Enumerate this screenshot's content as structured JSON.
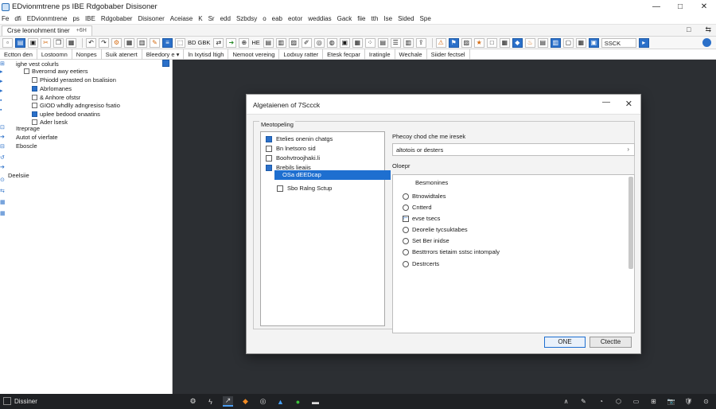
{
  "window": {
    "title": "EDvionmtrene ps IBE Rdgobaber Disisoner",
    "controls": {
      "minimize": "—",
      "maximize": "□",
      "close": "✕"
    }
  },
  "menu": {
    "items": [
      "Fe",
      "dfi",
      "EDvionmtrene",
      "ps",
      "IBE",
      "Rdgobaber",
      "Disisoner",
      "Aceiase",
      "K",
      "Sr",
      "edd",
      "Szbdsy",
      "o",
      "eab",
      "eotor",
      "weddias",
      "Gack",
      "fiie",
      "tth",
      "Ise",
      "Sided",
      "Spe"
    ]
  },
  "address": {
    "tab_label": "Crse leonohment tiner",
    "tab_suffix": "+6H",
    "right_items": [
      "□",
      "⇆"
    ]
  },
  "toolbar": {
    "text_a": "BD GBK",
    "text_b": "HE",
    "field_value": "SSCK"
  },
  "propbar": {
    "items": [
      "Ectton den",
      "Lostoomn",
      "Nonpes",
      "Suik atenert",
      "Bleedory e ▾",
      "ln Ixytisd ltigh",
      "Nemoot vereing",
      "Lodxuy ratter",
      "Etesk fecpar",
      "Iratingle",
      "Wechale",
      "Siider fectsel"
    ]
  },
  "tree": {
    "rows": [
      {
        "text": "ighe vest colurls",
        "depth": 1,
        "icon": "none"
      },
      {
        "text": "Bverornd awy eetiers",
        "depth": 2,
        "icon": "box"
      },
      {
        "text": "Phiodd yerasted on bsalision",
        "depth": 3,
        "icon": "box"
      },
      {
        "text": "Abrlomanes",
        "depth": 3,
        "icon": "blue"
      },
      {
        "text": "& Anhore ofstsr",
        "depth": 3,
        "icon": "box"
      },
      {
        "text": "GIOD whdlly adngresiso fsatio",
        "depth": 3,
        "icon": "box"
      },
      {
        "text": "uplee bedood onaatins",
        "depth": 3,
        "icon": "blue"
      },
      {
        "text": "Ader lsesk",
        "depth": 3,
        "icon": "box"
      },
      {
        "text": "Itreprage",
        "depth": 1,
        "icon": "none"
      },
      {
        "text": "Autot of vierfate",
        "depth": 1,
        "icon": "none"
      },
      {
        "text": "Eboscle",
        "depth": 1,
        "icon": "none"
      },
      {
        "text": "Deelsiie",
        "depth": 0,
        "icon": "none"
      }
    ]
  },
  "dialog": {
    "title": "Algetaienen of 7Sccck",
    "minimize": "—",
    "close": "✕",
    "group_label": "Meotopeling",
    "left_list": [
      {
        "text": "Etelies onenin chatgs",
        "kind": "blue"
      },
      {
        "text": "Bn lnetsoro sid",
        "kind": "box"
      },
      {
        "text": "Boohvtroojhaki.li",
        "kind": "box"
      },
      {
        "text": "Brebils lieaiis",
        "kind": "blue"
      }
    ],
    "left_selected": "OSa dEEDcap",
    "left_sub": "Sbo Ralng Sctup",
    "right": {
      "label1": "Phecoy chod che me iresek",
      "input_value": "altotois or desters",
      "input_arrow": "›",
      "label2": "Oloepr",
      "options_header": "Besmonines",
      "options": [
        {
          "text": "Btnowidtales",
          "kind": "radio"
        },
        {
          "text": "Cntterd",
          "kind": "radio"
        },
        {
          "text": "evse tsecs",
          "kind": "check"
        },
        {
          "text": "Deorelie tycsuktabes",
          "kind": "radio"
        },
        {
          "text": "Set Ber inidse",
          "kind": "radio"
        },
        {
          "text": "Besttrrors tietaim sstsc intompaly",
          "kind": "radio"
        },
        {
          "text": "Destrcerts",
          "kind": "radio"
        }
      ]
    },
    "ok_label": "ONE",
    "cancel_label": "Ctectte"
  },
  "taskbar": {
    "label": "Dissiner",
    "tray": [
      "∧",
      "✎",
      "◔",
      "⬡",
      "▭",
      "⊞",
      "📷",
      "🛡",
      "⊙"
    ]
  }
}
